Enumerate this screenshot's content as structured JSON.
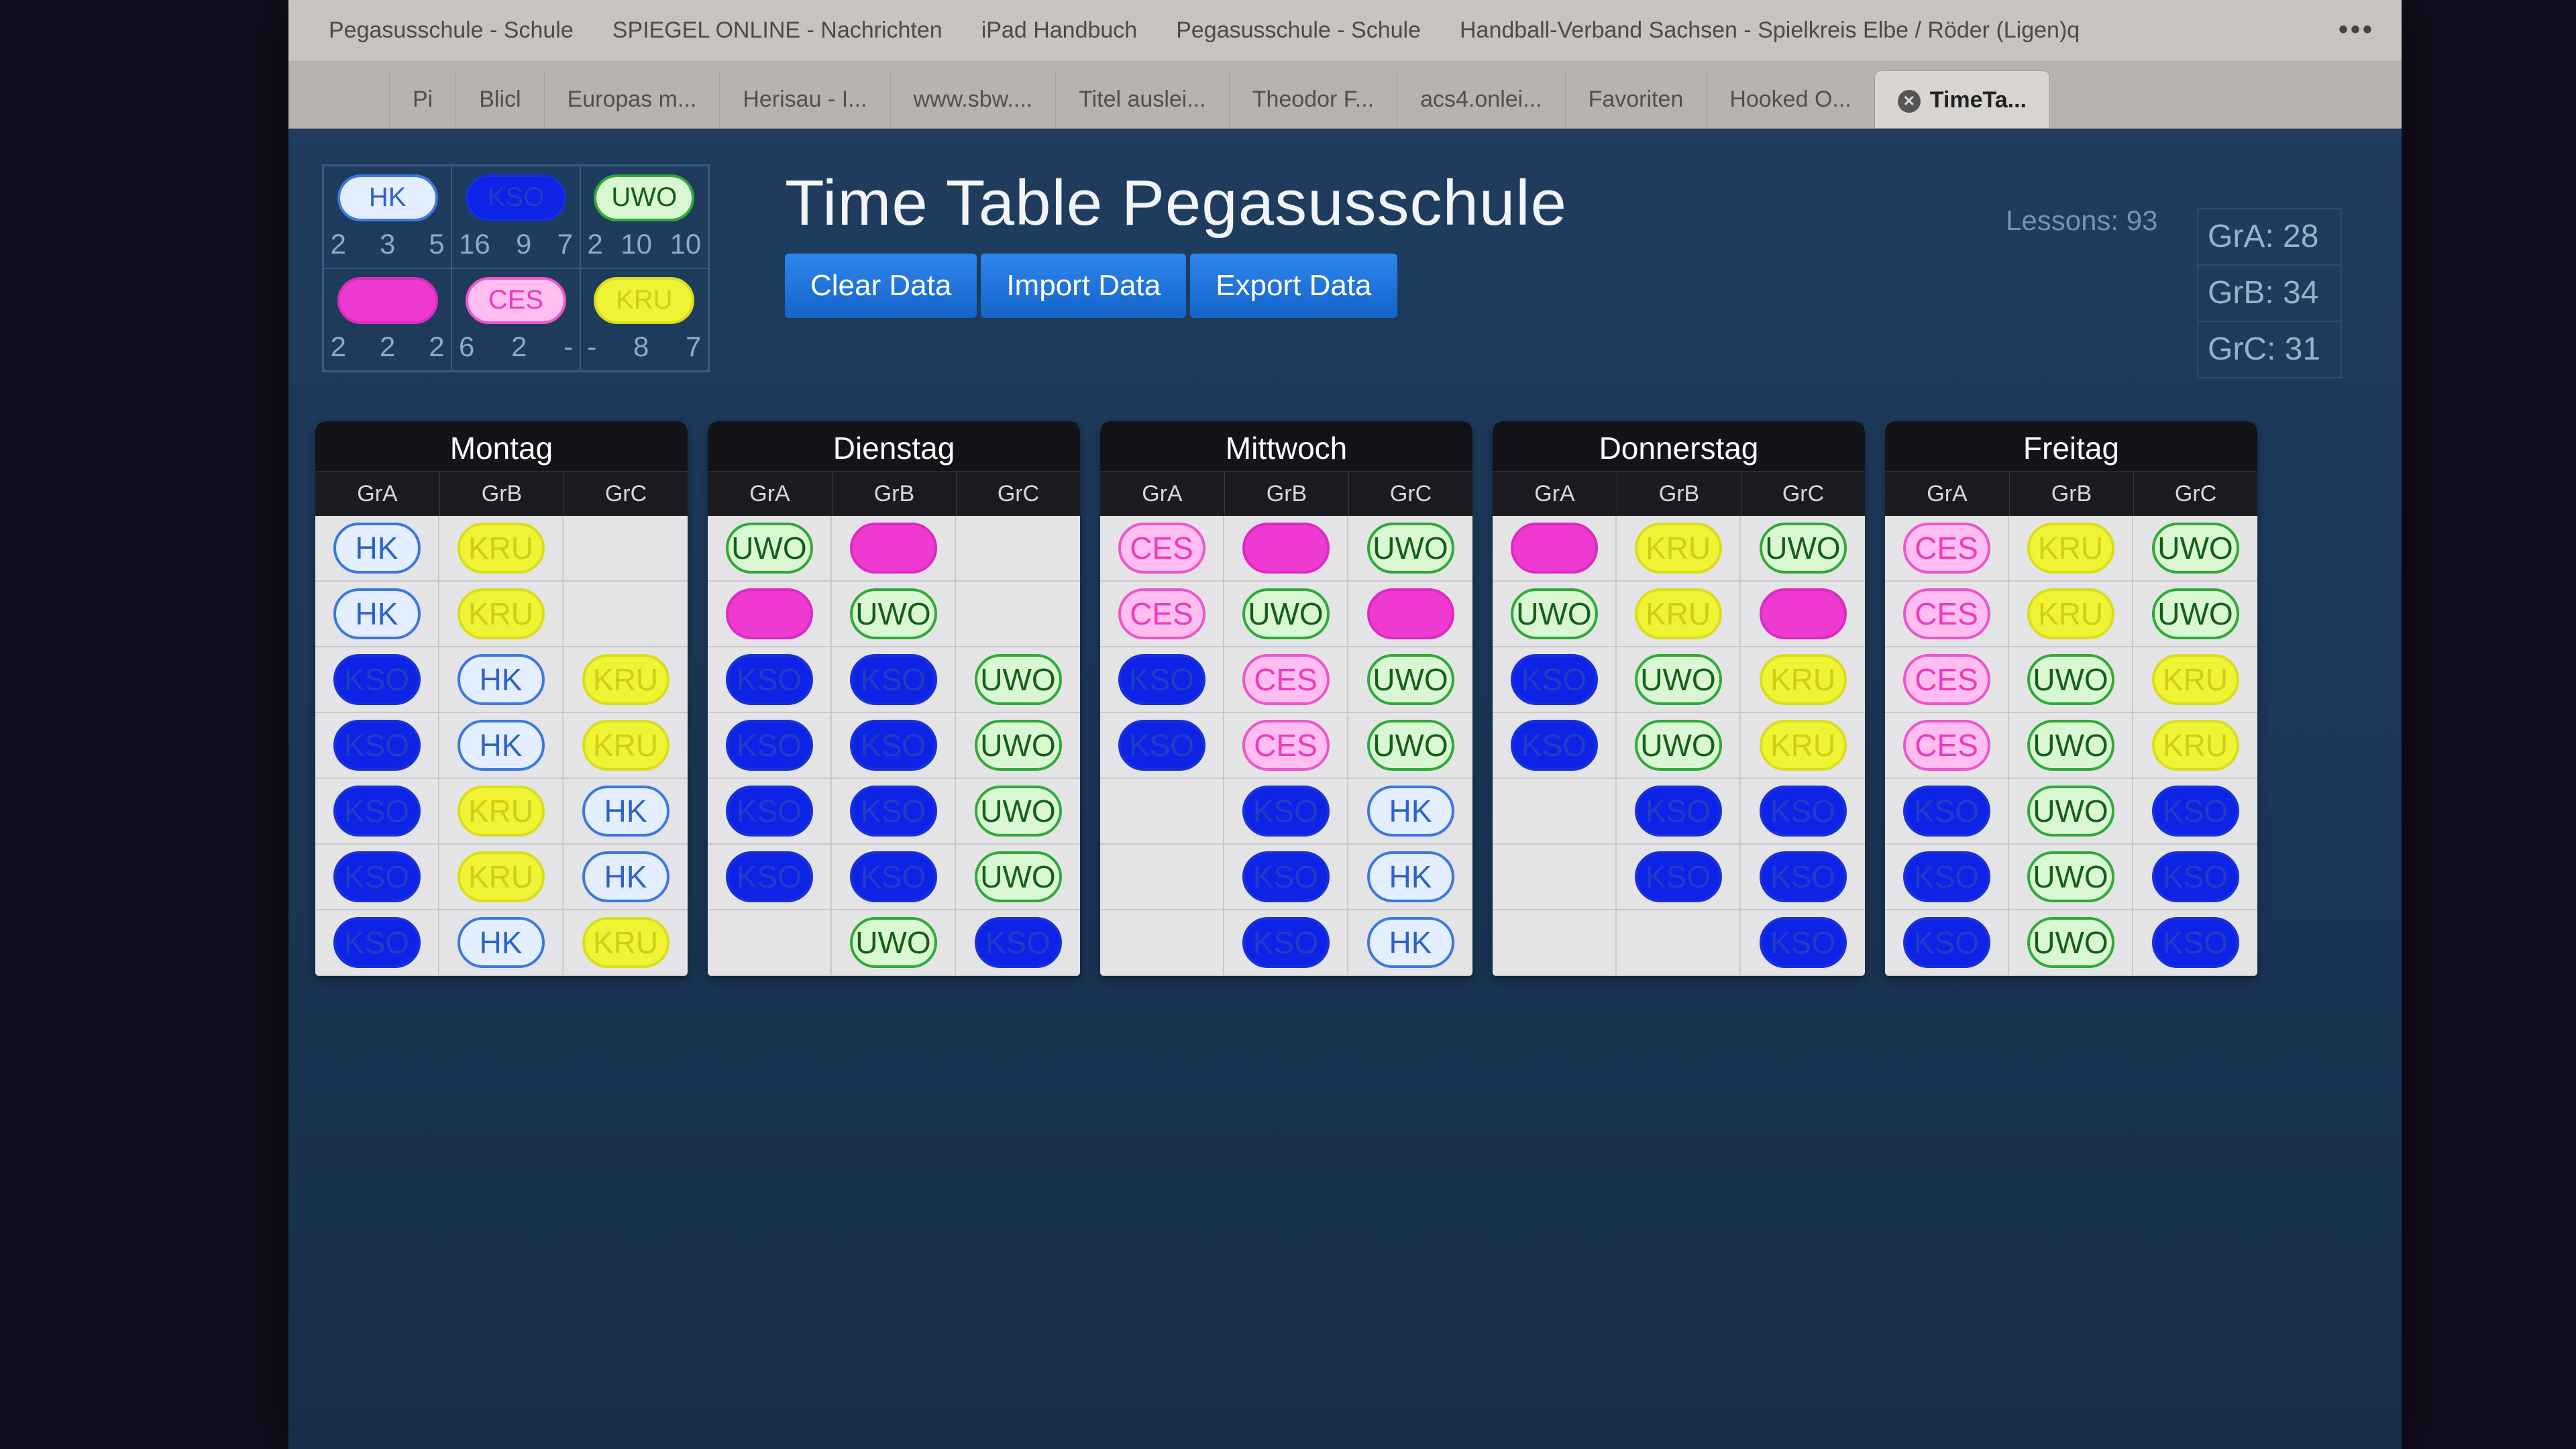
{
  "browser": {
    "bookmarks": [
      "Pegasusschule - Schule",
      "SPIEGEL ONLINE - Nachrichten",
      "iPad Handbuch",
      "Pegasusschule - Schule",
      "Handball-Verband Sachsen - Spielkreis Elbe / Röder (Ligen)q"
    ],
    "more_label": "•••",
    "tabs": [
      "Pi",
      "Blicl",
      "Europas m...",
      "Herisau - I...",
      "www.sbw....",
      "Titel auslei...",
      "Theodor F...",
      "acs4.onlei...",
      "Favoriten",
      "Hooked O...",
      "TimeTa..."
    ],
    "close_glyph": "✕"
  },
  "app": {
    "title": "Time Table Pegasusschule",
    "buttons": {
      "clear": "Clear Data",
      "import": "Import Data",
      "export": "Export Data"
    },
    "lessons_label": "Lessons: 93",
    "group_stats": [
      "GrA: 28",
      "GrB: 34",
      "GrC: 31"
    ]
  },
  "legend": [
    {
      "label": "HK",
      "type": "hk",
      "counts": [
        "2",
        "3",
        "5"
      ]
    },
    {
      "label": "KSO",
      "type": "kso",
      "counts": [
        "16",
        "9",
        "7"
      ]
    },
    {
      "label": "UWO",
      "type": "uwo",
      "counts": [
        "2",
        "10",
        "10"
      ]
    },
    {
      "label": "",
      "type": "mag",
      "counts": [
        "2",
        "2",
        "2"
      ]
    },
    {
      "label": "CES",
      "type": "ces",
      "counts": [
        "6",
        "2",
        "-"
      ]
    },
    {
      "label": "KRU",
      "type": "kru",
      "counts": [
        "-",
        "8",
        "7"
      ]
    }
  ],
  "groups": [
    "GrA",
    "GrB",
    "GrC"
  ],
  "days": [
    {
      "name": "Montag",
      "rows": [
        [
          "HK",
          "KRU",
          ""
        ],
        [
          "HK",
          "KRU",
          ""
        ],
        [
          "KSO",
          "HK",
          "KRU"
        ],
        [
          "KSO",
          "HK",
          "KRU"
        ],
        [
          "KSO",
          "KRU",
          "HK"
        ],
        [
          "KSO",
          "KRU",
          "HK"
        ],
        [
          "KSO",
          "HK",
          "KRU"
        ]
      ]
    },
    {
      "name": "Dienstag",
      "rows": [
        [
          "UWO",
          "MAG",
          ""
        ],
        [
          "MAG",
          "UWO",
          ""
        ],
        [
          "KSO",
          "KSO",
          "UWO"
        ],
        [
          "KSO",
          "KSO",
          "UWO"
        ],
        [
          "KSO",
          "KSO",
          "UWO"
        ],
        [
          "KSO",
          "KSO",
          "UWO"
        ],
        [
          "",
          "UWO",
          "KSO"
        ]
      ]
    },
    {
      "name": "Mittwoch",
      "rows": [
        [
          "CES",
          "MAG",
          "UWO"
        ],
        [
          "CES",
          "UWO",
          "MAG"
        ],
        [
          "KSO",
          "CES",
          "UWO"
        ],
        [
          "KSO",
          "CES",
          "UWO"
        ],
        [
          "",
          "KSO",
          "HK"
        ],
        [
          "",
          "KSO",
          "HK"
        ],
        [
          "",
          "KSO",
          "HK"
        ]
      ]
    },
    {
      "name": "Donnerstag",
      "rows": [
        [
          "MAG",
          "KRU",
          "UWO"
        ],
        [
          "UWO",
          "KRU",
          "MAG"
        ],
        [
          "KSO",
          "UWO",
          "KRU"
        ],
        [
          "KSO",
          "UWO",
          "KRU"
        ],
        [
          "",
          "KSO",
          "KSO"
        ],
        [
          "",
          "KSO",
          "KSO"
        ],
        [
          "",
          "",
          "KSO"
        ]
      ]
    },
    {
      "name": "Freitag",
      "rows": [
        [
          "CES",
          "KRU",
          "UWO"
        ],
        [
          "CES",
          "KRU",
          "UWO"
        ],
        [
          "CES",
          "UWO",
          "KRU"
        ],
        [
          "CES",
          "UWO",
          "KRU"
        ],
        [
          "KSO",
          "UWO",
          "KSO"
        ],
        [
          "KSO",
          "UWO",
          "KSO"
        ],
        [
          "KSO",
          "UWO",
          "KSO"
        ]
      ]
    }
  ]
}
